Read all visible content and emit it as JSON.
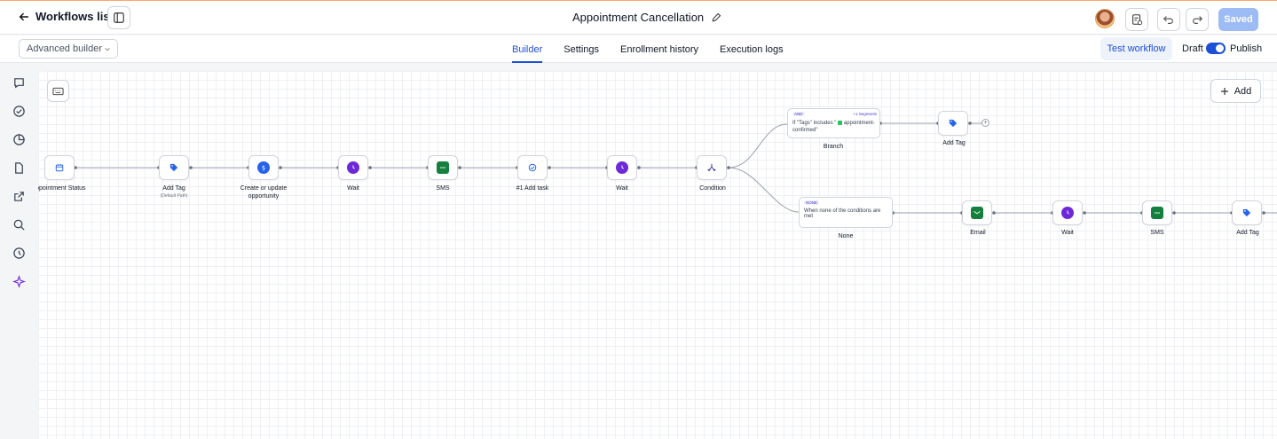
{
  "topbar": {
    "back_label": "Workflows list",
    "title": "Appointment Cancellation",
    "saved_label": "Saved"
  },
  "subbar": {
    "builder_mode": "Advanced builder",
    "tabs": [
      {
        "label": "Builder",
        "active": true
      },
      {
        "label": "Settings",
        "active": false
      },
      {
        "label": "Enrollment history",
        "active": false
      },
      {
        "label": "Execution logs",
        "active": false
      }
    ],
    "test_label": "Test workflow",
    "draft_label": "Draft",
    "publish_label": "Publish"
  },
  "sidebar": {
    "icons": [
      "chat-icon",
      "check-circle-icon",
      "pie-chart-icon",
      "file-icon",
      "external-link-icon",
      "search-icon",
      "history-icon",
      "sparkle-icon"
    ]
  },
  "canvas": {
    "add_label": "Add",
    "nodes": {
      "trigger": {
        "label": "Appointment Status"
      },
      "add_tag_1": {
        "label": "Add Tag",
        "sub": "(Default Path)"
      },
      "opportunity": {
        "label": "Create or update",
        "label2": "opportunity"
      },
      "wait_1": {
        "label": "Wait"
      },
      "sms_1": {
        "label": "SMS"
      },
      "task": {
        "label": "#1 Add task"
      },
      "wait_2": {
        "label": "Wait"
      },
      "condition": {
        "label": "Condition"
      },
      "branch": {
        "label": "Branch",
        "chip": "AND",
        "segments": "+1 Segments",
        "text": "If \"Tags\" includes \"",
        "tag": "appointment-confirmed\""
      },
      "add_tag_2": {
        "label": "Add Tag"
      },
      "none": {
        "label": "None",
        "chip": "NONE",
        "text": "When none of the conditions are met"
      },
      "email": {
        "label": "Email"
      },
      "wait_3": {
        "label": "Wait"
      },
      "sms_2": {
        "label": "SMS"
      },
      "add_tag_3": {
        "label": "Add Tag"
      }
    }
  },
  "colors": {
    "accent": "#1d4ed8",
    "tag": "#2563eb",
    "wait": "#6d28d9",
    "sms": "#15803d",
    "email": "#15803d",
    "opportunity": "#2563eb",
    "condition": "#3b3b9a"
  }
}
